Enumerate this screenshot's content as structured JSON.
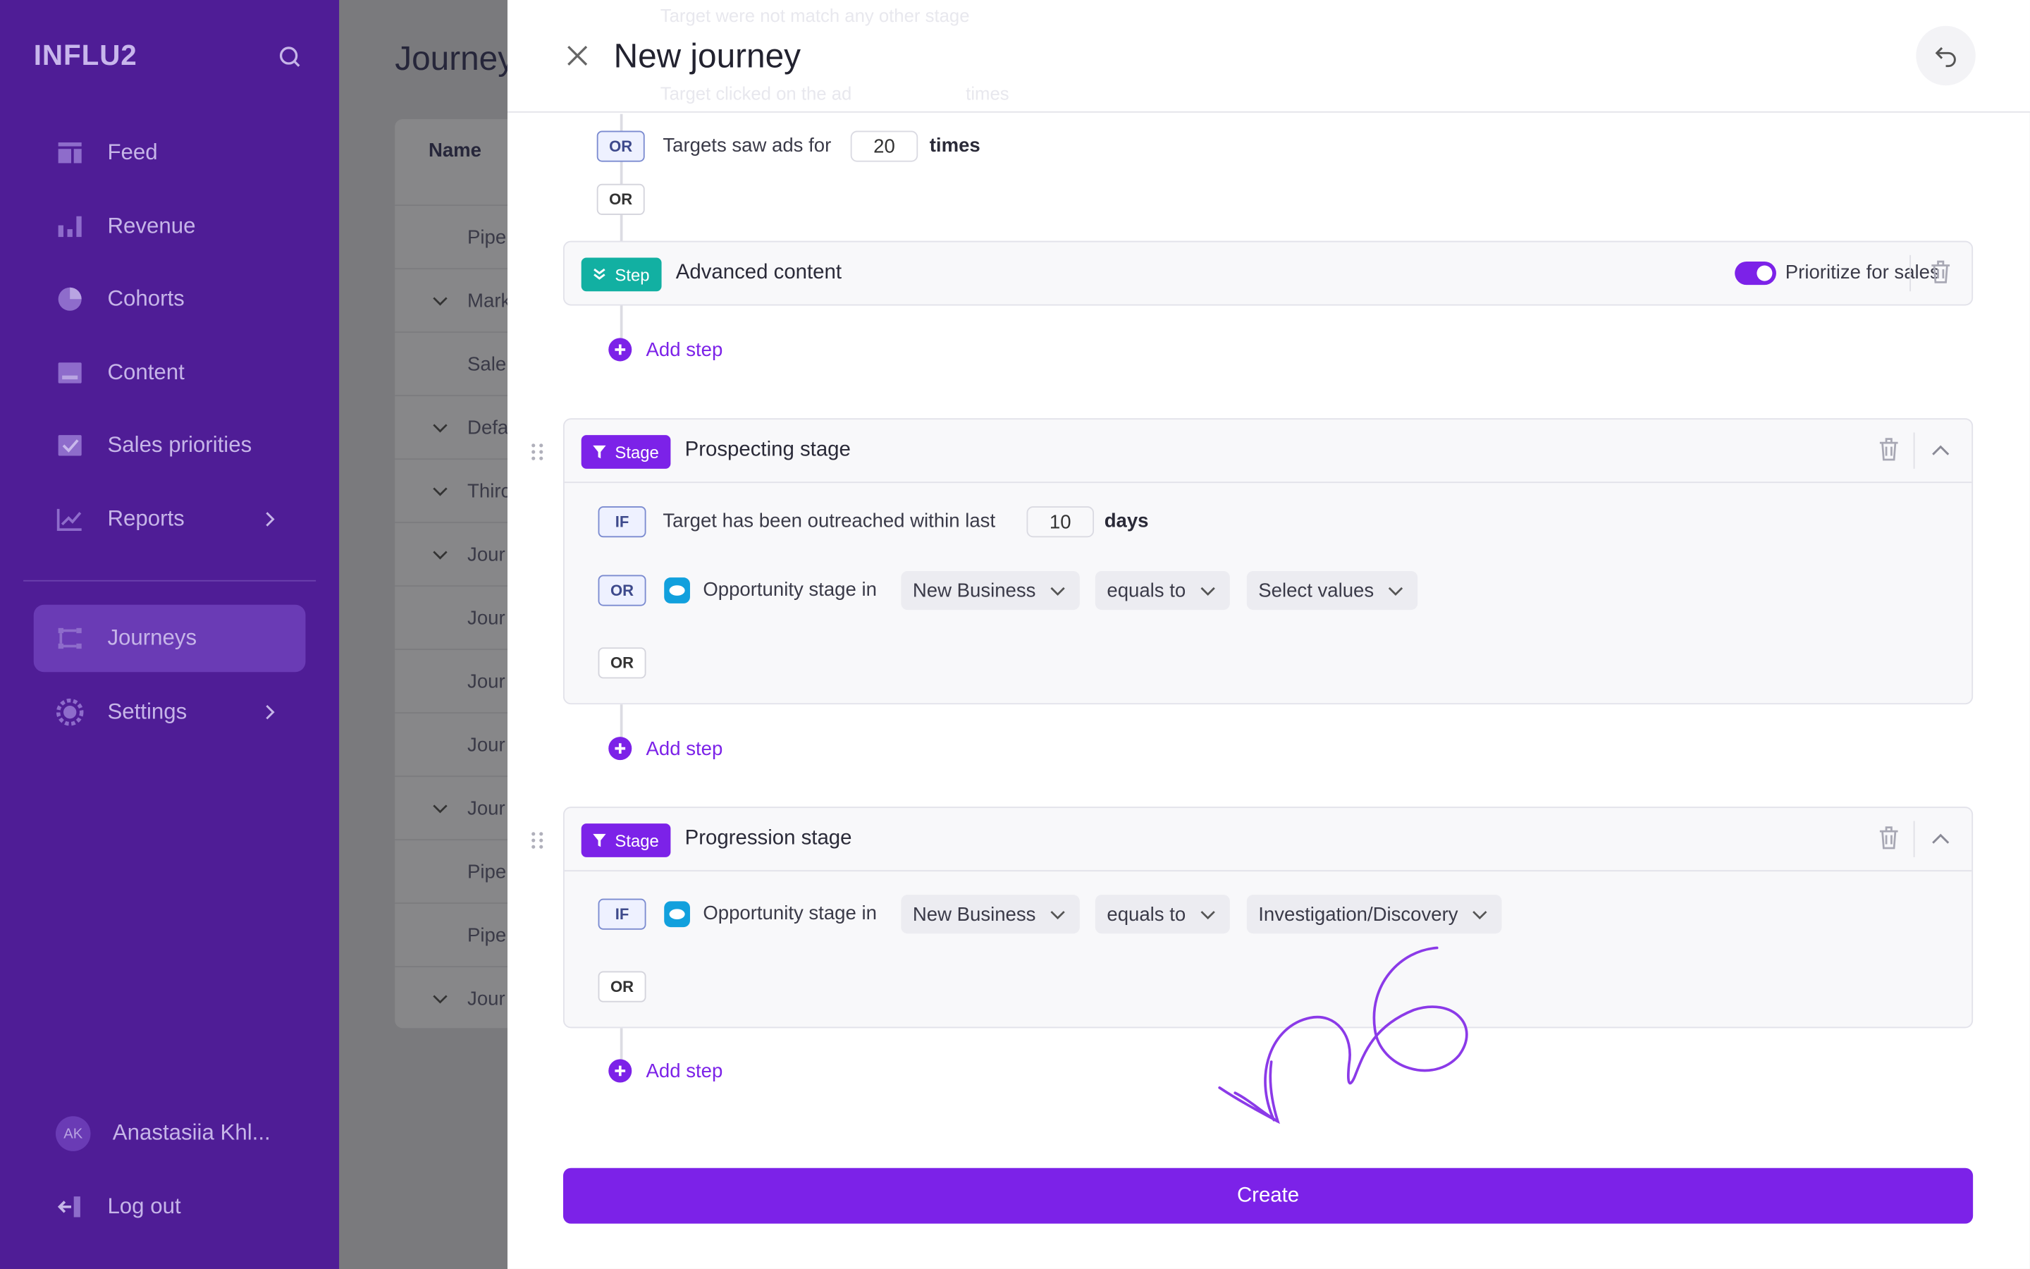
{
  "sidebar": {
    "logo": "INFLU2",
    "nav": [
      {
        "label": "Feed",
        "icon": "feed-icon"
      },
      {
        "label": "Revenue",
        "icon": "bar-chart-icon"
      },
      {
        "label": "Cohorts",
        "icon": "pie-chart-icon"
      },
      {
        "label": "Content",
        "icon": "content-icon"
      },
      {
        "label": "Sales priorities",
        "icon": "checkbox-icon"
      },
      {
        "label": "Reports",
        "icon": "line-chart-icon"
      },
      {
        "label": "Journeys",
        "icon": "journeys-icon",
        "active": true
      },
      {
        "label": "Settings",
        "icon": "gear-icon"
      }
    ],
    "user": {
      "initials": "AK",
      "name": "Anastasiia Khl..."
    },
    "logout": "Log out"
  },
  "background": {
    "title": "Journey",
    "column_header": "Name",
    "rows": [
      "Pipe",
      "Mark",
      "Sale",
      "Defa",
      "Thirc",
      "Jour",
      "Jour",
      "Jour",
      "Jour",
      "Jour",
      "Pipe",
      "Pipe",
      "Jour"
    ]
  },
  "panel": {
    "title": "New journey",
    "ghost_rows": [
      "Target were not match any other stage",
      "Target clicked on the ad",
      "times"
    ],
    "top_rule": {
      "tag": "OR",
      "text": "Targets saw ads for",
      "value": "20",
      "unit": "times"
    },
    "or_label": "OR",
    "step_card": {
      "badge": "Step",
      "title": "Advanced content",
      "toggle_label": "Prioritize for sales",
      "toggle_on": true
    },
    "add_step": "Add step",
    "stages": [
      {
        "badge": "Stage",
        "title": "Prospecting stage",
        "rule1": {
          "tag": "IF",
          "text": "Target has been outreached within last",
          "value": "10",
          "unit": "days"
        },
        "rule2": {
          "tag": "OR",
          "text": "Opportunity stage in",
          "dd1": "New Business",
          "dd2": "equals to",
          "dd3": "Select values"
        },
        "or_label": "OR"
      },
      {
        "badge": "Stage",
        "title": "Progression stage",
        "rule1": {
          "tag": "IF",
          "text": "Opportunity stage in",
          "dd1": "New Business",
          "dd2": "equals to",
          "dd3": "Investigation/Discovery"
        },
        "or_label": "OR"
      }
    ],
    "create_label": "Create"
  },
  "colors": {
    "sidebar_bg": "#4f1d96",
    "accent": "#7c22e8",
    "step_badge": "#12b0a2",
    "salesforce": "#11a0dd"
  }
}
